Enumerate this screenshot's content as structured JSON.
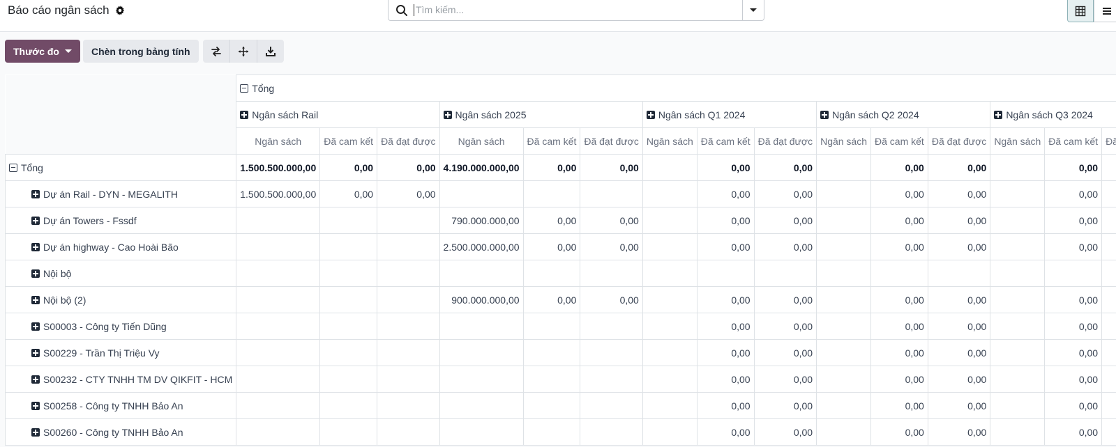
{
  "header": {
    "title": "Báo cáo ngân sách",
    "search_placeholder": "Tìm kiếm..."
  },
  "toolbar": {
    "measures_label": "Thước đo",
    "insert_label": "Chèn trong bảng tính"
  },
  "pivot": {
    "total_label": "Tổng",
    "groups": [
      "Ngân sách Rail",
      "Ngân sách 2025",
      "Ngân sách Q1 2024",
      "Ngân sách Q2 2024",
      "Ngân sách Q3 2024"
    ],
    "measures": [
      "Ngân sách",
      "Đã cam kết",
      "Đã đạt được"
    ],
    "total_row": {
      "label": "Tổng",
      "cells": [
        "1.500.500.000,00",
        "0,00",
        "0,00",
        "4.190.000.000,00",
        "0,00",
        "0,00",
        "",
        "0,00",
        "0,00",
        "",
        "0,00",
        "0,00",
        "",
        "0,00",
        ""
      ]
    },
    "rows": [
      {
        "label": "Dự án Rail - DYN - MEGALITH",
        "cells": [
          "1.500.500.000,00",
          "0,00",
          "0,00",
          "",
          "",
          "",
          "",
          "0,00",
          "0,00",
          "",
          "0,00",
          "0,00",
          "",
          "0,00",
          ""
        ]
      },
      {
        "label": "Dự án Towers - Fssdf",
        "cells": [
          "",
          "",
          "",
          "790.000.000,00",
          "0,00",
          "0,00",
          "",
          "0,00",
          "0,00",
          "",
          "0,00",
          "0,00",
          "",
          "0,00",
          ""
        ]
      },
      {
        "label": "Dự án highway - Cao Hoài Bão",
        "cells": [
          "",
          "",
          "",
          "2.500.000.000,00",
          "0,00",
          "0,00",
          "",
          "0,00",
          "0,00",
          "",
          "0,00",
          "0,00",
          "",
          "0,00",
          ""
        ]
      },
      {
        "label": "Nội bộ",
        "cells": [
          "",
          "",
          "",
          "",
          "",
          "",
          "",
          "",
          "",
          "",
          "",
          "",
          "",
          "",
          ""
        ]
      },
      {
        "label": "Nội bộ (2)",
        "cells": [
          "",
          "",
          "",
          "900.000.000,00",
          "0,00",
          "0,00",
          "",
          "0,00",
          "0,00",
          "",
          "0,00",
          "0,00",
          "",
          "0,00",
          ""
        ]
      },
      {
        "label": "S00003 - Công ty Tiến Dũng",
        "cells": [
          "",
          "",
          "",
          "",
          "",
          "",
          "",
          "0,00",
          "0,00",
          "",
          "0,00",
          "0,00",
          "",
          "0,00",
          ""
        ]
      },
      {
        "label": "S00229 - Trần Thị Triệu Vy",
        "cells": [
          "",
          "",
          "",
          "",
          "",
          "",
          "",
          "0,00",
          "0,00",
          "",
          "0,00",
          "0,00",
          "",
          "0,00",
          ""
        ]
      },
      {
        "label": "S00232 - CTY TNHH TM DV QIKFIT - HCM",
        "cells": [
          "",
          "",
          "",
          "",
          "",
          "",
          "",
          "0,00",
          "0,00",
          "",
          "0,00",
          "0,00",
          "",
          "0,00",
          ""
        ]
      },
      {
        "label": "S00258 - Công ty TNHH Bảo An",
        "cells": [
          "",
          "",
          "",
          "",
          "",
          "",
          "",
          "0,00",
          "0,00",
          "",
          "0,00",
          "0,00",
          "",
          "0,00",
          ""
        ]
      },
      {
        "label": "S00260 - Công ty TNHH Bảo An",
        "cells": [
          "",
          "",
          "",
          "",
          "",
          "",
          "",
          "0,00",
          "0,00",
          "",
          "0,00",
          "0,00",
          "",
          "0,00",
          ""
        ]
      }
    ]
  }
}
